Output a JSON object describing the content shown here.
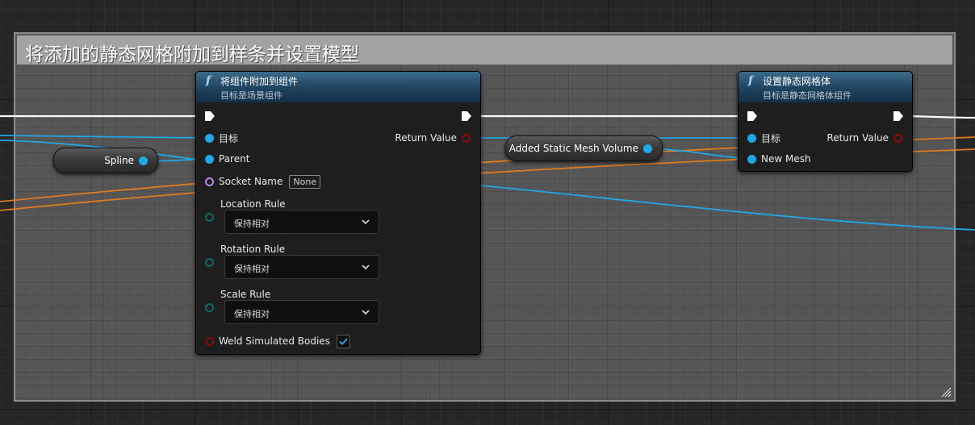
{
  "comment": {
    "title": "将添加的静态网格附加到样条并设置模型"
  },
  "attach_node": {
    "title": "将组件附加到组件",
    "subtitle": "目标是场景组件",
    "pins": {
      "target": "目标",
      "parent": "Parent",
      "socket_name": "Socket Name",
      "socket_name_value": "None",
      "location_rule": "Location Rule",
      "location_rule_value": "保持相对",
      "rotation_rule": "Rotation Rule",
      "rotation_rule_value": "保持相对",
      "scale_rule": "Scale Rule",
      "scale_rule_value": "保持相对",
      "weld_simulated_bodies": "Weld Simulated Bodies",
      "return_value": "Return Value"
    },
    "weld_checked": true
  },
  "set_mesh_node": {
    "title": "设置静态网格体",
    "subtitle": "目标是静态网格体组件",
    "pins": {
      "target": "目标",
      "new_mesh": "New Mesh",
      "return_value": "Return Value"
    }
  },
  "spline_node": {
    "label": "Spline"
  },
  "mesh_volume_node": {
    "label": "Added Static Mesh Volume"
  },
  "colors": {
    "exec_wire": "#ffffff",
    "object_pin": "#1fa7e6",
    "orange_wire": "#e07a1f",
    "function_header": "#2a5573"
  },
  "icons": {
    "function": "function-icon",
    "dropdown": "chevron-down-icon",
    "checkbox": "check-icon",
    "resize": "resize-grip-icon"
  }
}
